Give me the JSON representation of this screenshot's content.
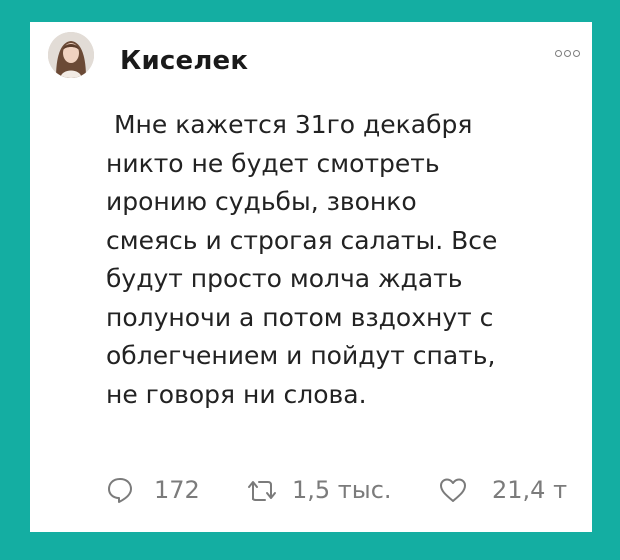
{
  "tweet": {
    "author": "Киселек",
    "text": " Мне кажется 31го декабря\nникто не будет смотреть\nиронию судьбы, звонко\nсмеясь и строгая салаты. Все\nбудут просто молча ждать\nполуночи а потом вздохнут с\nоблегчением и пойдут спать,\nне говоря ни слова.",
    "replies": "172",
    "retweets": "1,5 тыс.",
    "likes": "21,4 т"
  },
  "icons": {
    "avatar": "avatar",
    "more": "more-options-icon",
    "reply": "reply-icon",
    "retweet": "retweet-icon",
    "like": "heart-icon"
  },
  "colors": {
    "background": "#14aea2",
    "card": "#ffffff",
    "text": "#222222",
    "meta": "#7b7b7b"
  }
}
